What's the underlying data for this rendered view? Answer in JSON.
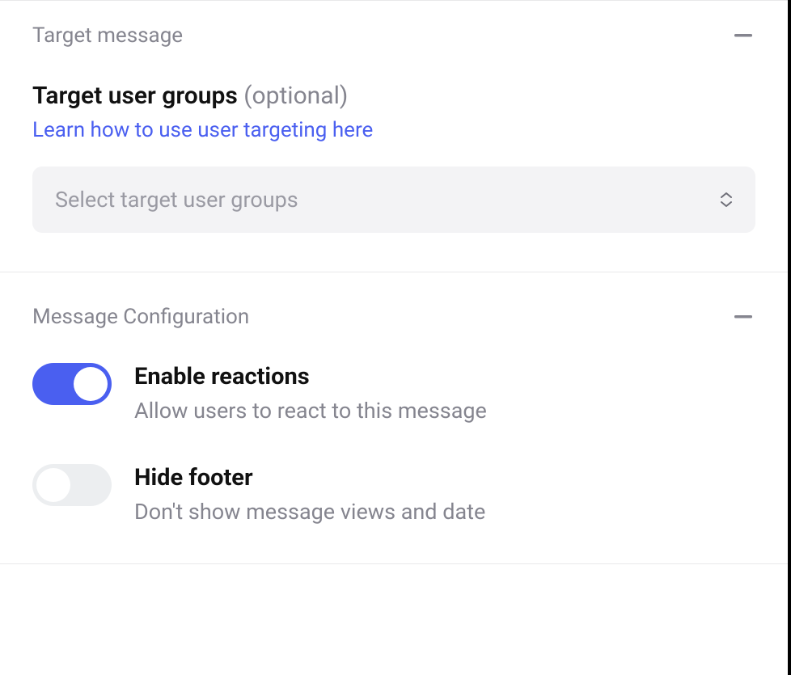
{
  "sections": {
    "target_message": {
      "header_title": "Target message",
      "field_title": "Target user groups",
      "field_title_suffix": "(optional)",
      "help_link_text": "Learn how to use user targeting here",
      "select_placeholder": "Select target user groups"
    },
    "message_configuration": {
      "header_title": "Message Configuration",
      "items": [
        {
          "label": "Enable reactions",
          "description": "Allow users to react to this message",
          "enabled": true
        },
        {
          "label": "Hide footer",
          "description": "Don't show message views and date",
          "enabled": false
        }
      ]
    }
  },
  "colors": {
    "accent": "#4a5ff0",
    "muted": "#85858f",
    "input_bg": "#f3f3f5",
    "toggle_off": "#eceef0"
  }
}
